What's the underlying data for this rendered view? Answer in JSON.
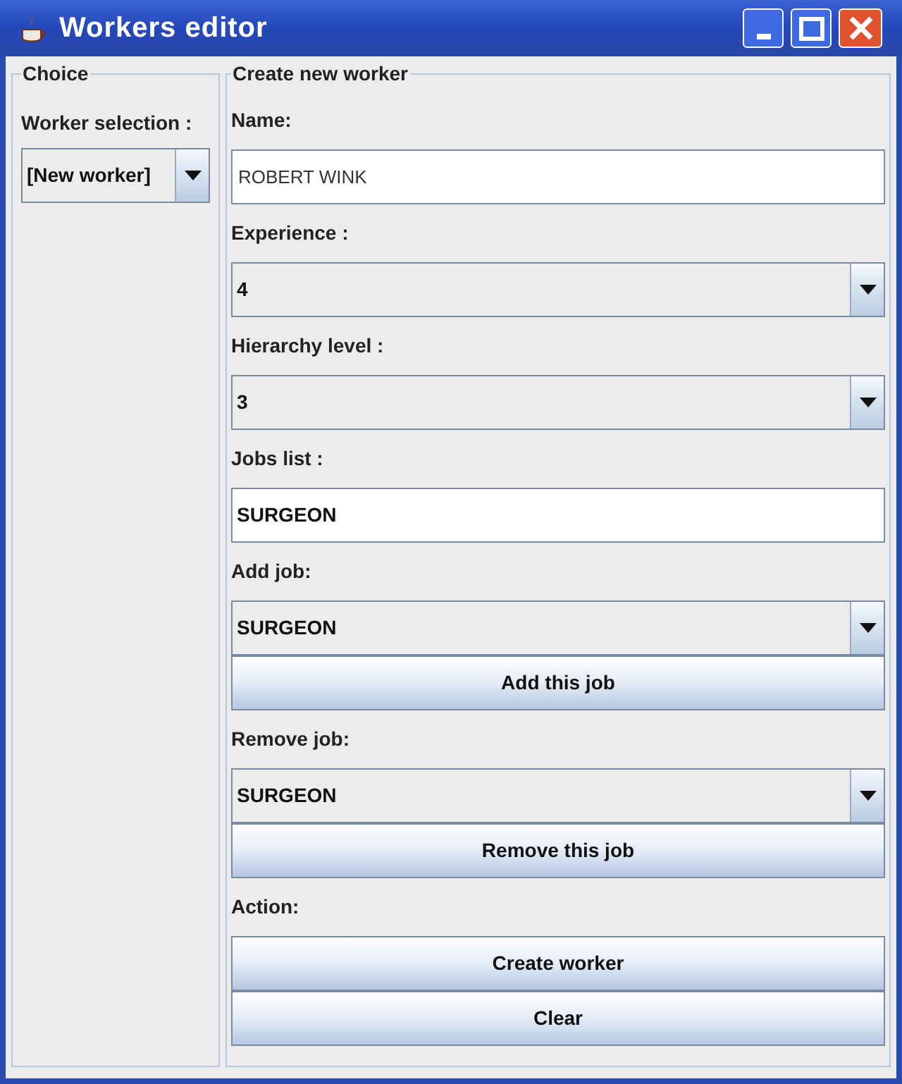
{
  "window": {
    "title": "Workers editor"
  },
  "choice_panel": {
    "title": "Choice",
    "label": "Worker selection :",
    "selection": "[New worker]"
  },
  "create_panel": {
    "title": "Create new worker",
    "items": [
      {
        "kind": "label",
        "text": "Name:"
      },
      {
        "kind": "field",
        "value": "ROBERT WINK"
      },
      {
        "kind": "label",
        "text": "Experience :"
      },
      {
        "kind": "combo",
        "value": "4"
      },
      {
        "kind": "label",
        "text": "Hierarchy level :"
      },
      {
        "kind": "combo",
        "value": "3"
      },
      {
        "kind": "label",
        "text": "Jobs list :"
      },
      {
        "kind": "list",
        "value": "SURGEON"
      },
      {
        "kind": "label",
        "text": "Add job:"
      },
      {
        "kind": "combo",
        "value": "SURGEON"
      },
      {
        "kind": "button",
        "text": "Add this job"
      },
      {
        "kind": "label",
        "text": "Remove job:"
      },
      {
        "kind": "combo",
        "value": "SURGEON"
      },
      {
        "kind": "button",
        "text": "Remove this job"
      },
      {
        "kind": "label",
        "text": "Action:"
      },
      {
        "kind": "button",
        "text": "Create worker"
      },
      {
        "kind": "button",
        "text": "Clear"
      }
    ]
  }
}
